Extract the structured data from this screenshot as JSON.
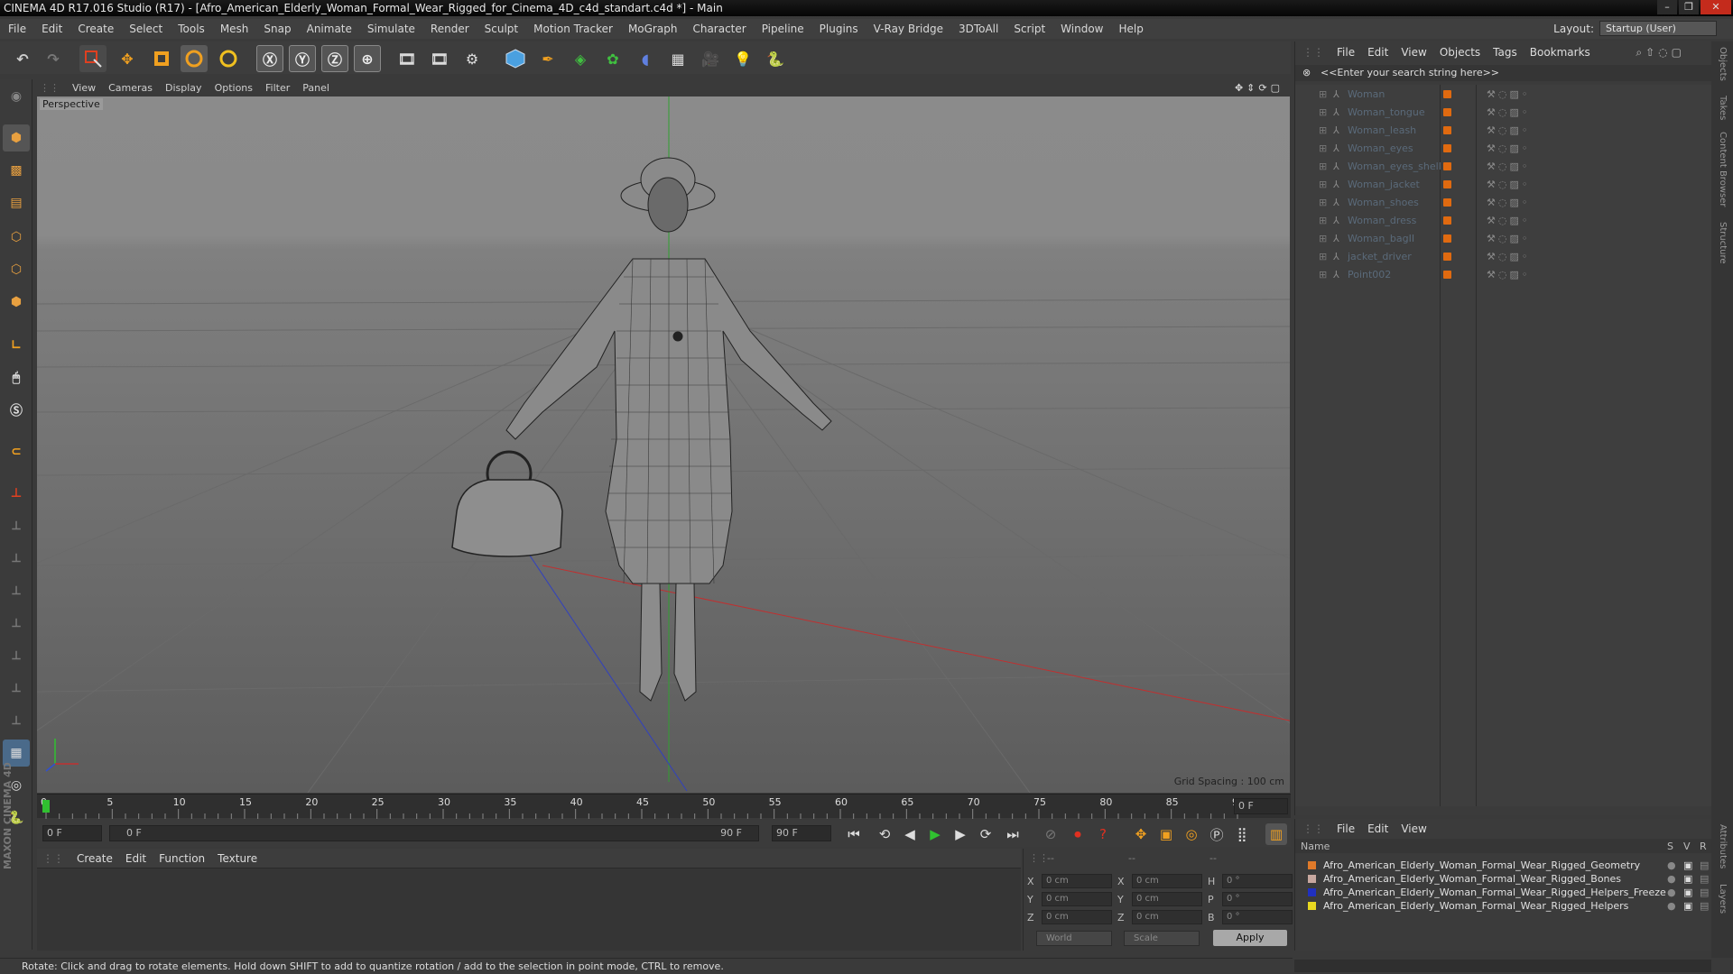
{
  "window": {
    "title": "CINEMA 4D R17.016 Studio (R17) - [Afro_American_Elderly_Woman_Formal_Wear_Rigged_for_Cinema_4D_c4d_standart.c4d *] - Main",
    "controls": [
      "–",
      "❐",
      "✕"
    ]
  },
  "menubar": [
    "File",
    "Edit",
    "Create",
    "Select",
    "Tools",
    "Mesh",
    "Snap",
    "Animate",
    "Simulate",
    "Render",
    "Sculpt",
    "Motion Tracker",
    "MoGraph",
    "Character",
    "Pipeline",
    "Plugins",
    "V-Ray Bridge",
    "3DToAll",
    "Script",
    "Window",
    "Help"
  ],
  "layout": {
    "label": "Layout:",
    "value": "Startup (User)"
  },
  "viewport": {
    "menu": [
      "View",
      "Cameras",
      "Display",
      "Options",
      "Filter",
      "Panel"
    ],
    "label": "Perspective",
    "grid_spacing": "Grid Spacing : 100 cm"
  },
  "timeline": {
    "ticks": [
      "0",
      "5",
      "10",
      "15",
      "20",
      "25",
      "30",
      "35",
      "40",
      "45",
      "50",
      "55",
      "60",
      "65",
      "70",
      "75",
      "80",
      "85",
      "90"
    ],
    "current_frame": "0 F",
    "start_field": "0 F",
    "range_start": "0 F",
    "range_end": "90 F",
    "end_field": "90 F"
  },
  "material_menu": [
    "Create",
    "Edit",
    "Function",
    "Texture"
  ],
  "coordinates": {
    "col1_header": "--",
    "col2_header": "--",
    "col3_header": "--",
    "rows": [
      {
        "l1": "X",
        "v1": "0 cm",
        "l2": "X",
        "v2": "0 cm",
        "l3": "H",
        "v3": "0 °"
      },
      {
        "l1": "Y",
        "v1": "0 cm",
        "l2": "Y",
        "v2": "0 cm",
        "l3": "P",
        "v3": "0 °"
      },
      {
        "l1": "Z",
        "v1": "0 cm",
        "l2": "Z",
        "v2": "0 cm",
        "l3": "B",
        "v3": "0 °"
      }
    ],
    "world": "World",
    "scale": "Scale",
    "apply": "Apply"
  },
  "status": "Rotate: Click and drag to rotate elements. Hold down SHIFT to add to quantize rotation / add to the selection in point mode, CTRL to remove.",
  "objects_panel": {
    "menu": [
      "File",
      "Edit",
      "View",
      "Objects",
      "Tags",
      "Bookmarks"
    ],
    "search_placeholder": "<<Enter your search string here>>",
    "items": [
      "Woman",
      "Woman_tongue",
      "Woman_leash",
      "Woman_eyes",
      "Woman_eyes_shell",
      "Woman_jacket",
      "Woman_shoes",
      "Woman_dress",
      "Woman_bagII",
      "jacket_driver",
      "Point002"
    ]
  },
  "right_tabs": [
    "Objects",
    "Takes",
    "Content Browser",
    "Structure"
  ],
  "right_tabs_bottom": [
    "Attributes",
    "Layers"
  ],
  "layers_panel": {
    "menu": [
      "File",
      "Edit",
      "View"
    ],
    "header": {
      "name": "Name",
      "s": "S",
      "v": "V",
      "r": "R"
    },
    "layers": [
      {
        "name": "Afro_American_Elderly_Woman_Formal_Wear_Rigged_Geometry",
        "color": "#e07a2a"
      },
      {
        "name": "Afro_American_Elderly_Woman_Formal_Wear_Rigged_Bones",
        "color": "#c8a8a0"
      },
      {
        "name": "Afro_American_Elderly_Woman_Formal_Wear_Rigged_Helpers_Freeze",
        "color": "#2030c0"
      },
      {
        "name": "Afro_American_Elderly_Woman_Formal_Wear_Rigged_Helpers",
        "color": "#e8d820"
      }
    ]
  },
  "brand": "MAXON CINEMA 4D"
}
